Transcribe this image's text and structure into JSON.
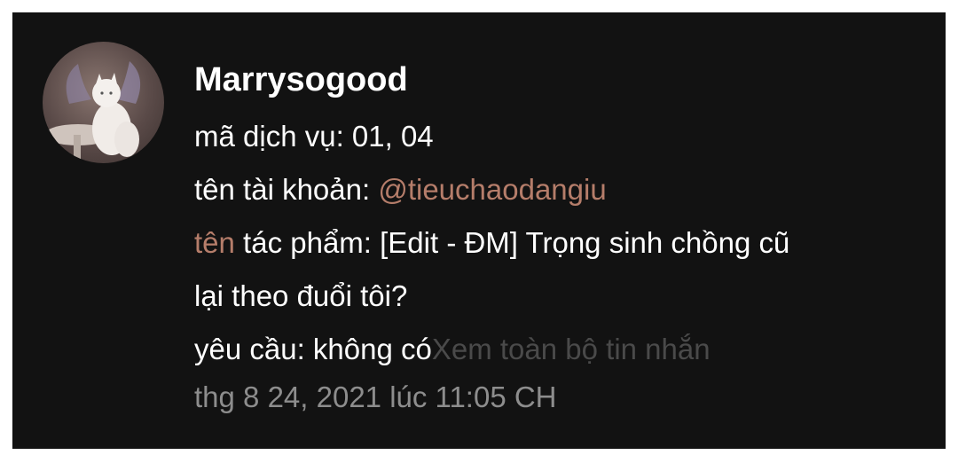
{
  "message": {
    "author": "Marrysogood",
    "avatar_icon": "white-cat-photo",
    "lines": [
      {
        "text": "mã dịch vụ: 01, 04"
      },
      {
        "label": "tên tài khoản: ",
        "mention": "@tieuchaodangiu"
      },
      {
        "link_word": "tên",
        "text": " tác phẩm: [Edit - ĐM] Trọng sinh chồng cũ"
      },
      {
        "text": "lại theo đuổi tôi?"
      },
      {
        "text": "yêu cầu: không có",
        "see_all": "Xem toàn bộ tin nhắn"
      }
    ],
    "timestamp": "thg 8 24, 2021 lúc 11:05 CH"
  },
  "colors": {
    "background": "#121212",
    "accent": "#b57d6a",
    "muted": "#8d8d8d",
    "see_all": "#4a4a4a"
  }
}
